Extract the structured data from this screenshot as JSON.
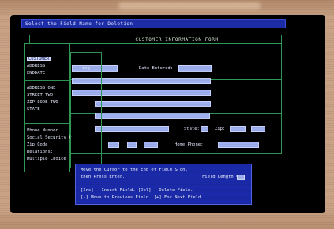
{
  "colors": {
    "screen_bg": "#000000",
    "title_bar": "#1d2da8",
    "form_border": "#2f9a55",
    "field_fill": "#9fb0f0",
    "help_bg": "#1a2aa8",
    "bezel": "#c9a184"
  },
  "title_bar": "Select the Field Name for Deletion",
  "form": {
    "title": "CUSTOMER INFORMATION FORM",
    "date_entered_label": "Date Entered:",
    "state_label": "State:",
    "zip_label": "Zip:",
    "home_phone_label": "Home Phone:"
  },
  "field_menu": {
    "items_top": [
      "CUSTOMER",
      "ADDRESS",
      "ENDDATE"
    ],
    "top_suffix": "ing",
    "items_mid": [
      "ADDRESS ONE",
      "STREET TWO",
      "ZIP CODE TWO",
      "STATE"
    ],
    "items_bottom": [
      "Phone Number",
      "Social Security #",
      "Zip Code",
      "Relations:",
      "Multiple Choice"
    ]
  },
  "help": {
    "line1": "Move the Cursor to the End of Field & on,",
    "line2a": "then Press Enter.",
    "line2b": "Field Length =",
    "field_length": "",
    "line3": "[Ins] - Insert Field.  [Del] - Delete Field.",
    "line4": "[-] Move to Previous Field.  [+] For Next Field."
  }
}
